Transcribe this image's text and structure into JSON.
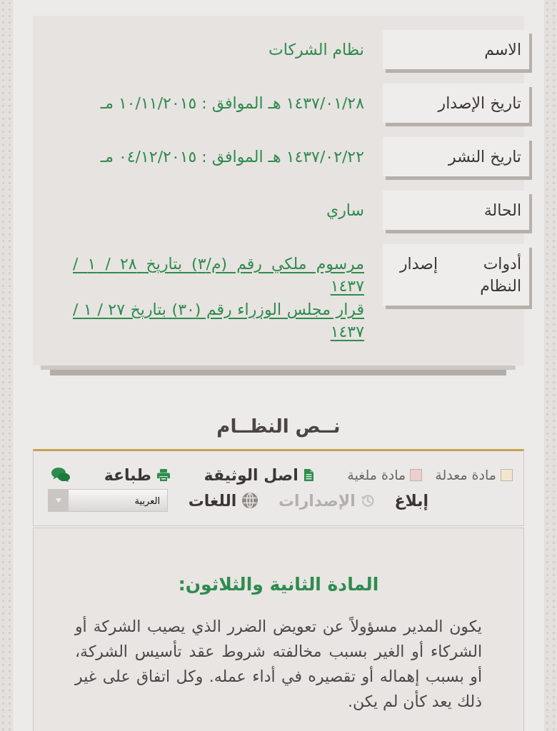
{
  "info": {
    "rows": [
      {
        "kind": "text",
        "label": "الاسم",
        "value": "نظام الشركات"
      },
      {
        "kind": "text",
        "label": "تاريخ الإصدار",
        "value": "١٤٣٧/٠١/٢٨ هـ الموافق : ١٠/١١/٢٠١٥ مـ"
      },
      {
        "kind": "text",
        "label": "تاريخ النشر",
        "value": "١٤٣٧/٠٢/٢٢ هـ الموافق : ٠٤/١٢/٢٠١٥ مـ"
      },
      {
        "kind": "text",
        "label": "الحالة",
        "value": "ساري"
      },
      {
        "kind": "links",
        "label": "أدوات إصدار النظام",
        "links": [
          "مرسوم ملكي رقم (م/٣) بتاريخ ٢٨ / ١ / ١٤٣٧",
          "قرار مجلس الوزراء رقم (٣٠) بتاريخ ٢٧ / ١ / ١٤٣٧"
        ]
      }
    ]
  },
  "section_title": "نــص النظــام",
  "toolbar": {
    "legend": [
      {
        "label": "مادة معدلة",
        "color": "#f2e6cf"
      },
      {
        "label": "مادة ملغية",
        "color": "#eecfcf"
      }
    ],
    "tools": [
      {
        "kind": "document",
        "label": "اصل الوثيقة",
        "disabled": false
      },
      {
        "kind": "print",
        "label": "طباعة",
        "disabled": false
      },
      {
        "kind": "comment",
        "disabled": false
      },
      {
        "kind": "report",
        "label": "إبلاغ",
        "disabled": false
      },
      {
        "kind": "history",
        "label": "الإصدارات",
        "disabled": true
      },
      {
        "kind": "languages",
        "label": "اللغات",
        "disabled": false
      }
    ],
    "language_select": {
      "value": "العربية"
    }
  },
  "article": {
    "title": "المادة الثانية والثلاثون:",
    "text": "يكون المدير مسؤولاً عن تعويض الضرر الذي يصيب الشركة أو الشركاء أو الغير بسبب مخالفته شروط عقد تأسيس الشركة، أو بسبب إهماله أو تقصيره في أداء عمله. وكل اتفاق على غير ذلك يعد كأن لم يكن."
  }
}
